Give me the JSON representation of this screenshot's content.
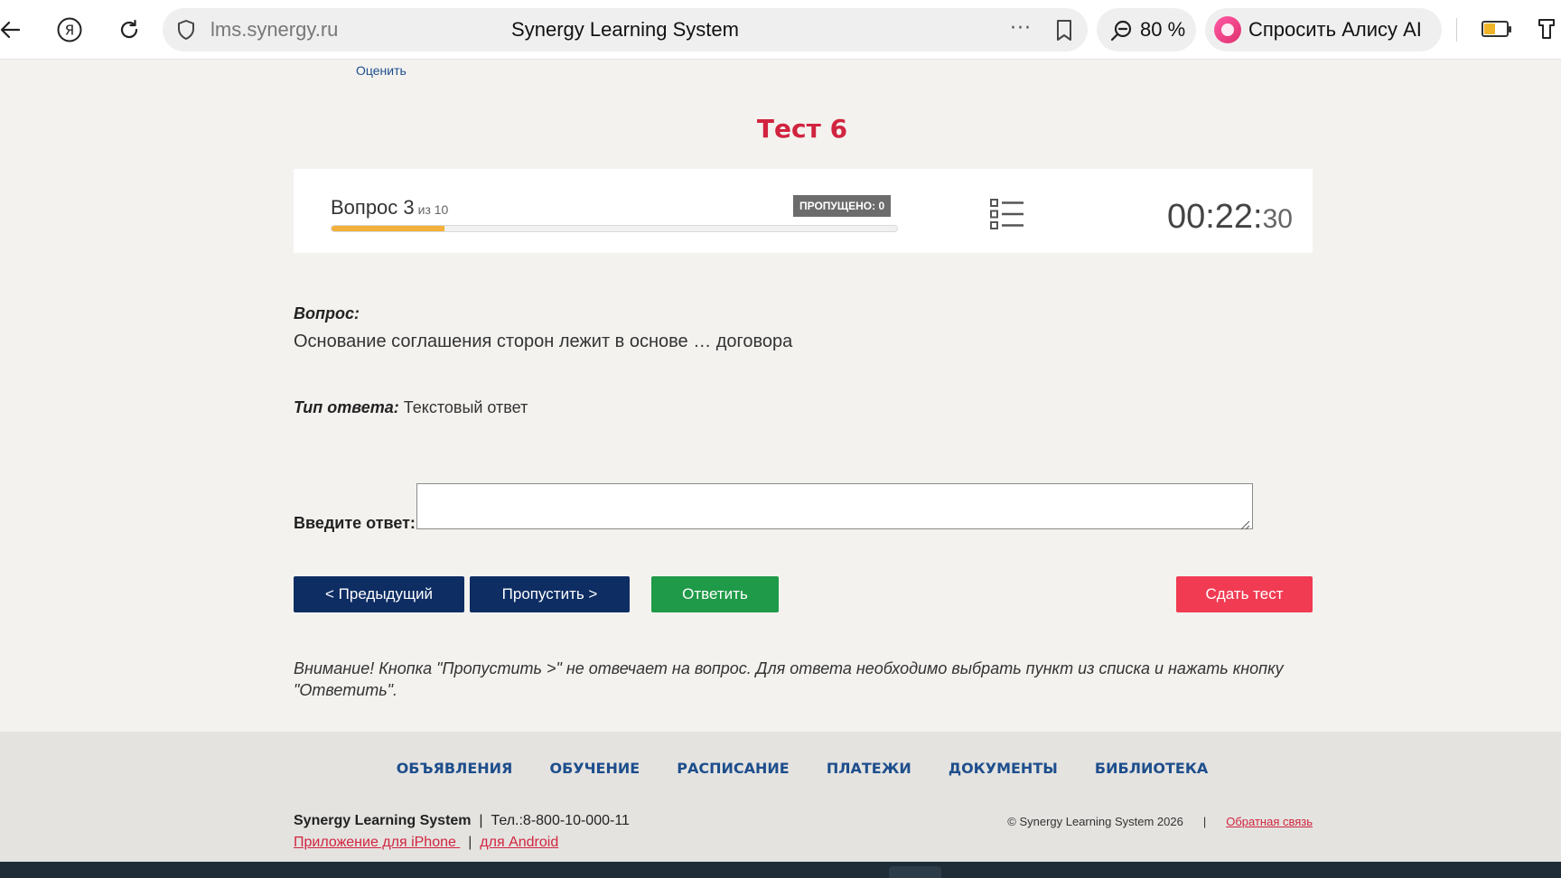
{
  "browser": {
    "url": "lms.synergy.ru",
    "page_title": "Synergy Learning System",
    "more_glyph": "···",
    "zoom": "80 %",
    "alice_label": "Спросить Алису AI"
  },
  "page": {
    "rate_link": "Оценить",
    "test_title": "Тест 6"
  },
  "progress": {
    "question_label": "Вопрос 3",
    "of_label": "из 10",
    "skipped_badge": "ПРОПУЩЕНО: 0",
    "progress_fraction": 0.2,
    "timer_main": "00:22:",
    "timer_seconds": "30"
  },
  "question": {
    "label": "Вопрос:",
    "text": "Основание соглашения сторон лежит в основе … договора",
    "type_label": "Тип ответа:",
    "type_value": " Текстовый ответ"
  },
  "answer": {
    "label": "Введите ответ:",
    "value": ""
  },
  "buttons": {
    "prev": "< Предыдущий",
    "skip": "Пропустить >",
    "answer": "Ответить",
    "submit": "Сдать тест"
  },
  "warning": "Внимание! Кнопка \"Пропустить >\" не отвечает на вопрос. Для ответа необходимо выбрать пункт из списка и нажать кнопку \"Ответить\".",
  "footer": {
    "nav": [
      "ОБЪЯВЛЕНИЯ",
      "ОБУЧЕНИЕ",
      "РАСПИСАНИЕ",
      "ПЛАТЕЖИ",
      "ДОКУМЕНТЫ",
      "БИБЛИОТЕКА"
    ],
    "brand": "Synergy Learning System",
    "phone": "  |  Тел.:8-800-10-000-11",
    "iphone_link": "Приложение для iPhone ",
    "divider": "  |  ",
    "android_link": "для Android",
    "copyright": "© Synergy Learning System 2026",
    "copy_sep": "|",
    "feedback_link": "Обратная связь"
  },
  "colors": {
    "title_red": "#d1243f",
    "nav_blue": "#1e4e8c",
    "button_navy": "#0d2d63",
    "button_green": "#1f9a48",
    "button_red": "#f13b53",
    "progress_orange": "#f3b13b"
  },
  "icons": {
    "back": "arrow-left-icon",
    "yandex": "yandex-logo-icon",
    "reload": "reload-icon",
    "shield": "shield-icon",
    "bookmark": "bookmark-icon",
    "zoom": "magnifier-icon",
    "alice": "alice-icon",
    "battery": "battery-icon",
    "extension": "extension-icon",
    "question_list": "list-icon"
  }
}
